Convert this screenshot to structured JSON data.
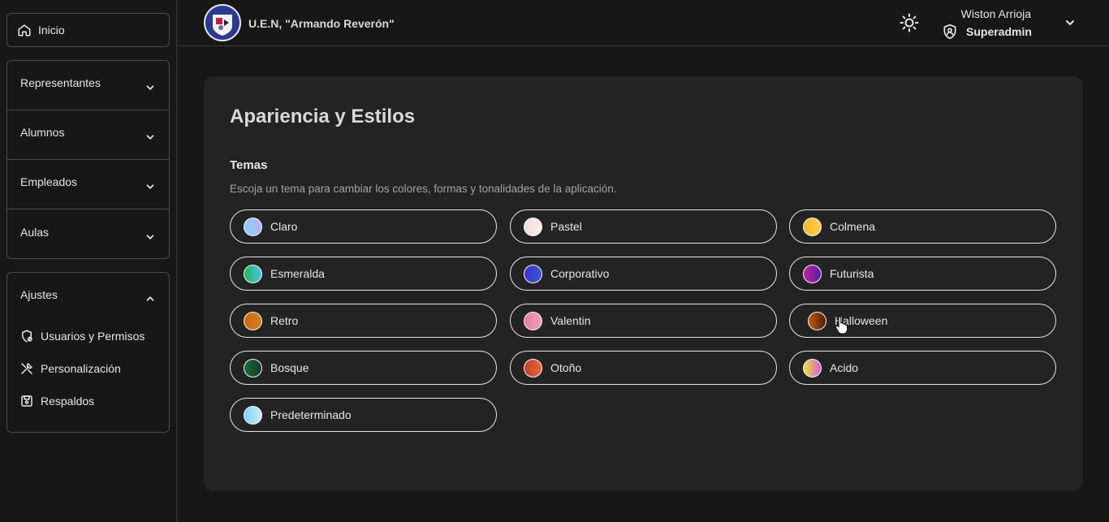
{
  "sidebar": {
    "home_label": "Inicio",
    "groups": [
      {
        "label": "Representantes"
      },
      {
        "label": "Alumnos"
      },
      {
        "label": "Empleados"
      },
      {
        "label": "Aulas"
      }
    ],
    "settings": {
      "label": "Ajustes",
      "items": [
        {
          "label": "Usuarios y Permisos",
          "icon": "shield-gear-icon"
        },
        {
          "label": "Personalización",
          "icon": "tools-icon"
        },
        {
          "label": "Respaldos",
          "icon": "save-icon"
        }
      ]
    }
  },
  "header": {
    "school_name": "U.E.N, \"Armando Reverón\"",
    "user_name": "Wiston Arrioja",
    "user_role": "Superadmin"
  },
  "main": {
    "title": "Apariencia y Estilos",
    "section_title": "Temas",
    "section_description": "Escoja un tema para cambiar los colores, formas y tonalidades de la aplicación.",
    "themes": [
      {
        "label": "Claro",
        "colors": [
          "#7fd6f5",
          "#b9b3f0"
        ]
      },
      {
        "label": "Pastel",
        "colors": [
          "#f7d7e3",
          "#fbf0e6"
        ]
      },
      {
        "label": "Colmena",
        "colors": [
          "#f6b62a",
          "#f9d24a"
        ]
      },
      {
        "label": "Esmeralda",
        "colors": [
          "#1fb955",
          "#4ec2e8"
        ]
      },
      {
        "label": "Corporativo",
        "colors": [
          "#3a35c9",
          "#3c55d6"
        ]
      },
      {
        "label": "Futurista",
        "colors": [
          "#c21fa6",
          "#5a1f9c"
        ]
      },
      {
        "label": "Retro",
        "colors": [
          "#cf6a12",
          "#d07e1c"
        ]
      },
      {
        "label": "Valentin",
        "colors": [
          "#e57aa3",
          "#f0a0bf"
        ]
      },
      {
        "label": "Halloween",
        "colors": [
          "#c75a10",
          "#4a1f08"
        ]
      },
      {
        "label": "Bosque",
        "colors": [
          "#1c6b3c",
          "#0f3d22"
        ]
      },
      {
        "label": "Otoño",
        "colors": [
          "#c43b2a",
          "#e26b3a"
        ]
      },
      {
        "label": "Acido",
        "colors": [
          "#f0e52a",
          "#d65fe0"
        ]
      },
      {
        "label": "Predeterminado",
        "colors": [
          "#7ad2f5",
          "#c9eef9"
        ]
      }
    ]
  }
}
